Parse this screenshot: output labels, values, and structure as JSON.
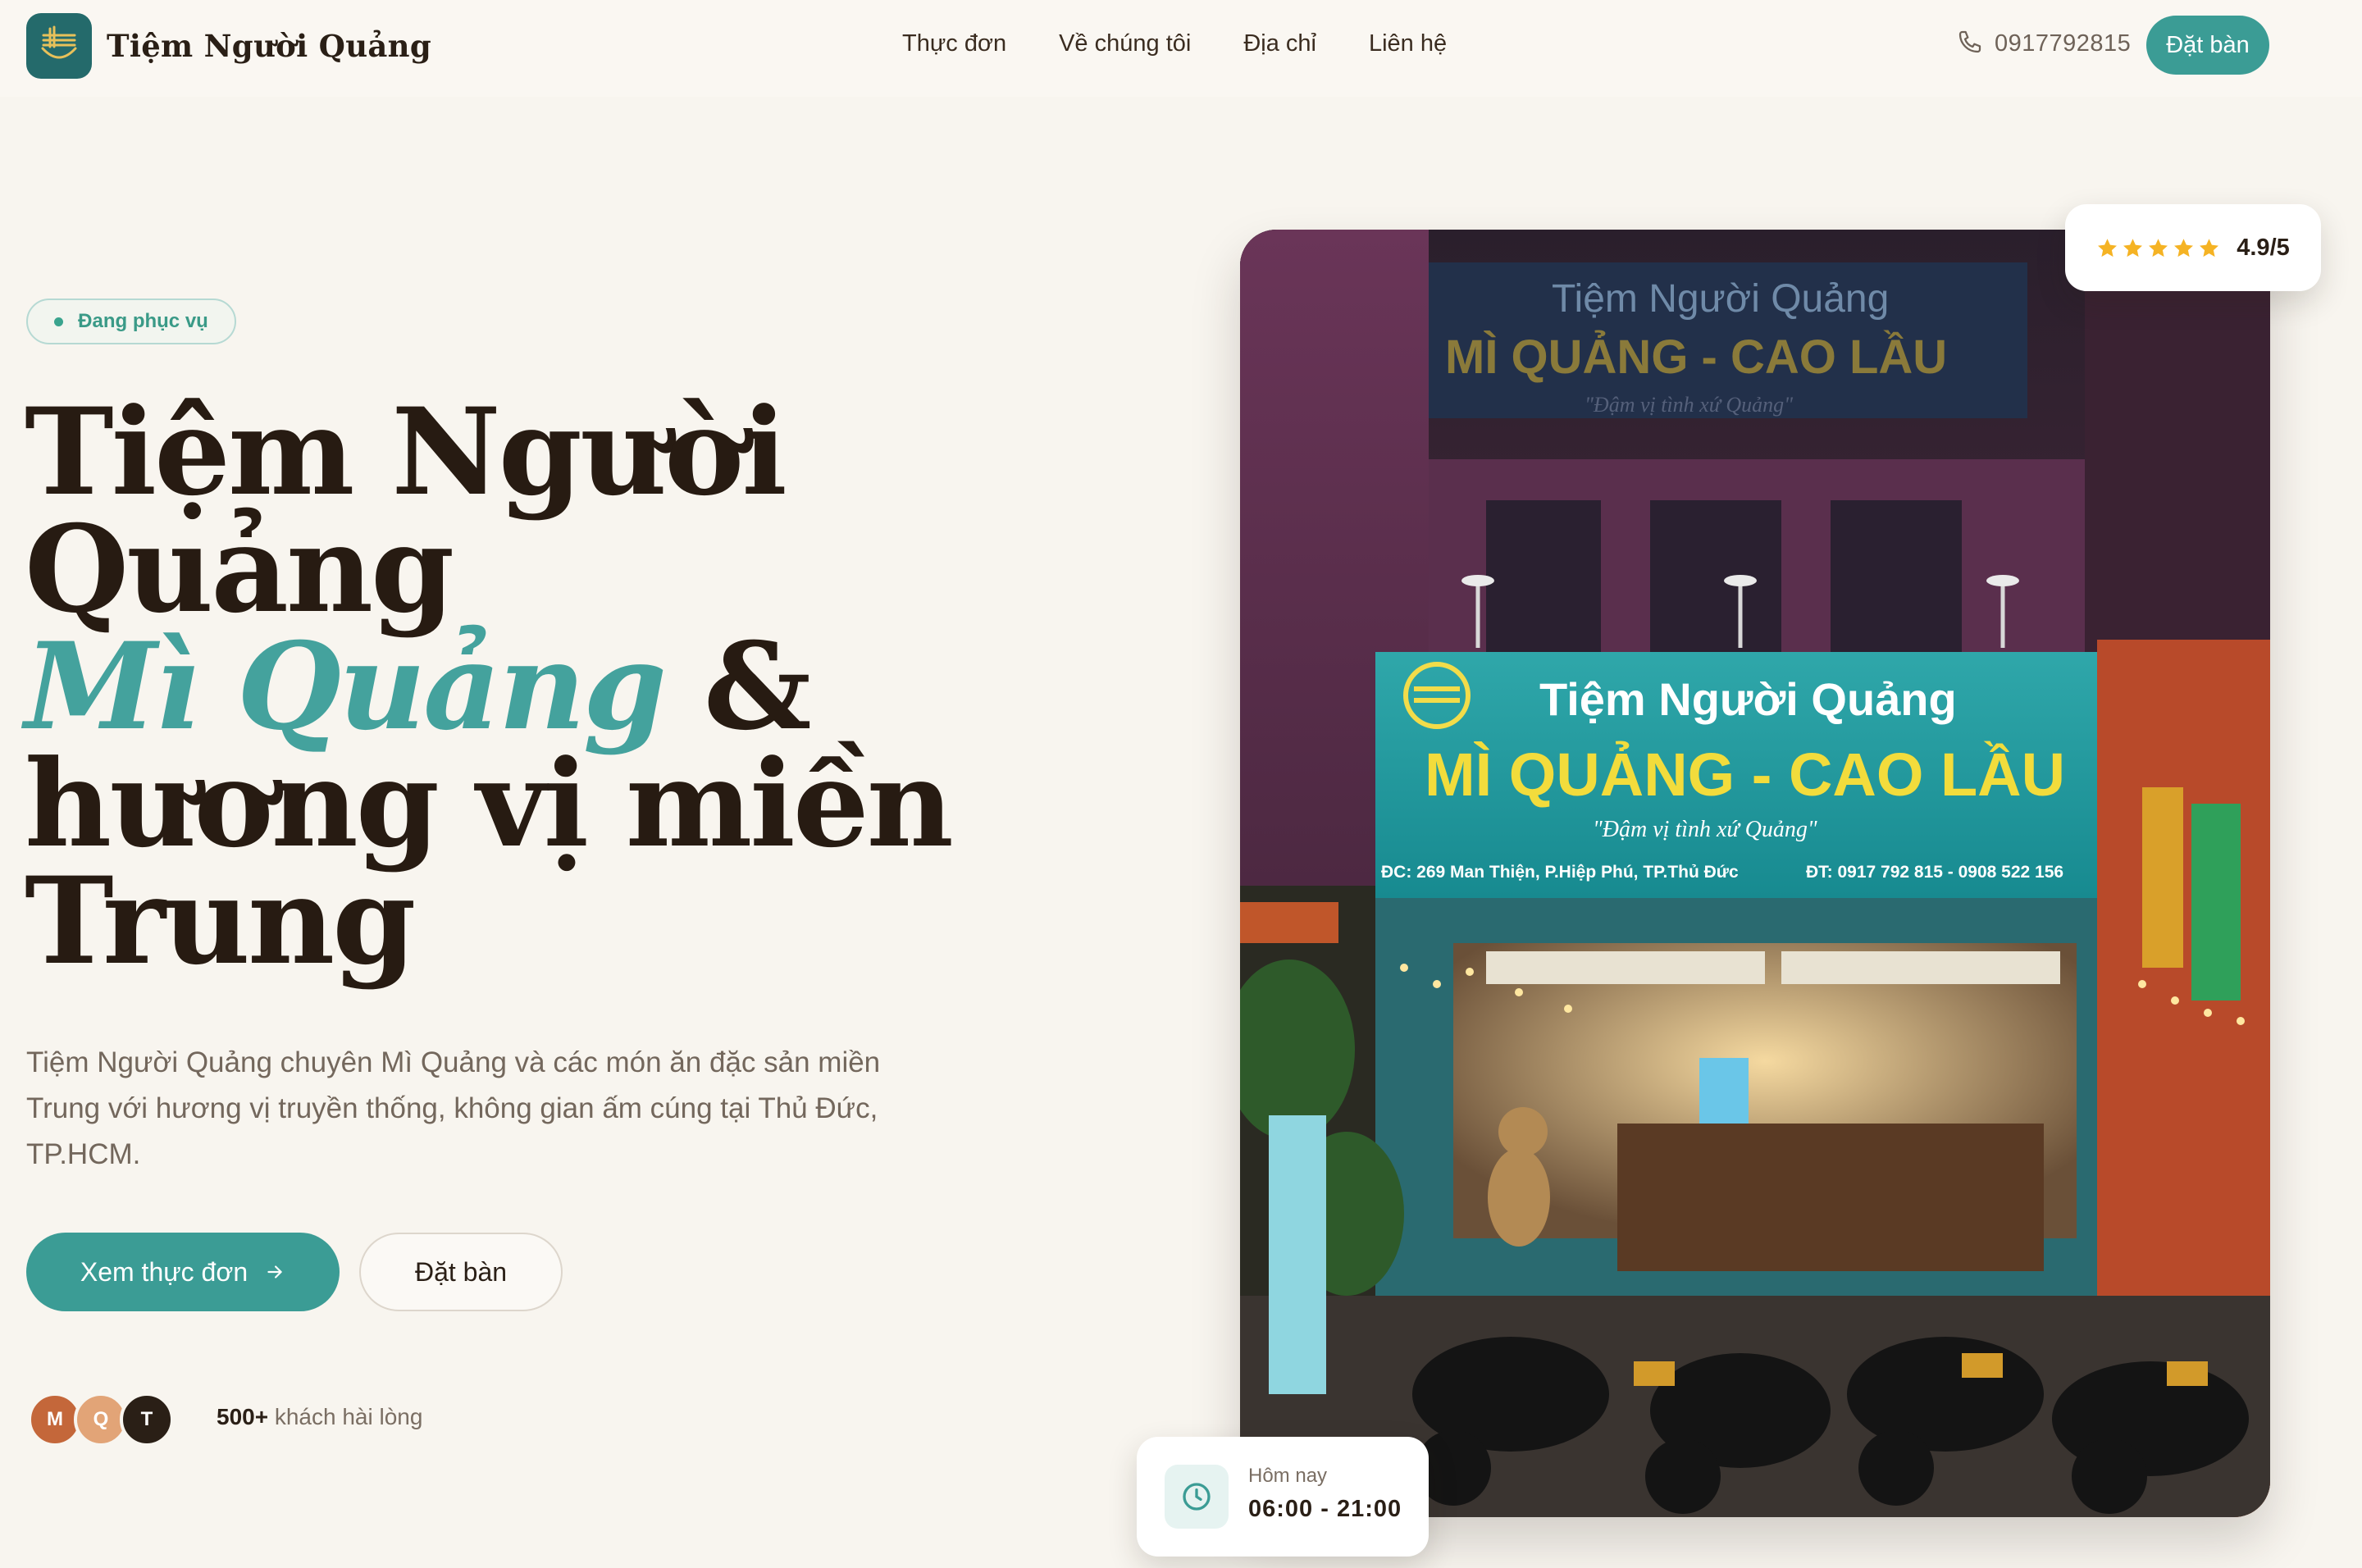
{
  "nav": {
    "brand_name": "Tiệm Người Quảng",
    "menu": [
      "Thực đơn",
      "Về chúng tôi",
      "Địa chỉ",
      "Liên hệ"
    ],
    "phone": "0917792815",
    "cta_label": "Đặt bàn",
    "icons": {
      "logo": "bowl-noodle-logo",
      "phone": "phone-icon"
    }
  },
  "hero": {
    "badge": "Đang phục vụ",
    "title_line1": "Tiệm Người",
    "title_line2": "Quảng",
    "title_accent": "Mì Quảng",
    "title_amp": " &",
    "title_line4": "hương vị miền",
    "title_line5": "Trung",
    "description": "Tiệm Người Quảng chuyên Mì Quảng và các món ăn đặc sản miền Trung với hương vị truyền thống, không gian ấm cúng tại Thủ Đức, TP.HCM.",
    "primary_button": "Xem thực đơn",
    "secondary_button": "Đặt bàn",
    "avatars": [
      "M",
      "Q",
      "T"
    ],
    "social_count": "500+",
    "social_text": " khách hài lòng"
  },
  "photo_card": {
    "rating_value": "4.9/5",
    "stars": 5,
    "hours_label": "Hôm nay",
    "hours_value": "06:00 - 21:00",
    "sign": {
      "top_title": "Tiệm Người Quảng",
      "top_subtitle": "MÌ QUẢNG - CAO LẦU",
      "top_slogan": "\"Đậm vị tình xứ Quảng\"",
      "main_title": "Tiệm Người Quảng",
      "main_subtitle": "MÌ QUẢNG - CAO LẦU",
      "main_slogan": "\"Đậm vị tình xứ Quảng\"",
      "address": "ĐC: 269 Man Thiện, P.Hiệp Phú, TP.Thủ Đức",
      "phone_line": "ĐT: 0917 792 815 - 0908 522 156"
    }
  },
  "colors": {
    "accent": "#3b9c95",
    "headline_accent": "#44a29d",
    "text_dark": "#271b12",
    "background": "#f8f5ef",
    "star": "#f5b324",
    "avatar_colors": [
      "#c4673a",
      "#e2a477",
      "#2a1f16"
    ]
  }
}
